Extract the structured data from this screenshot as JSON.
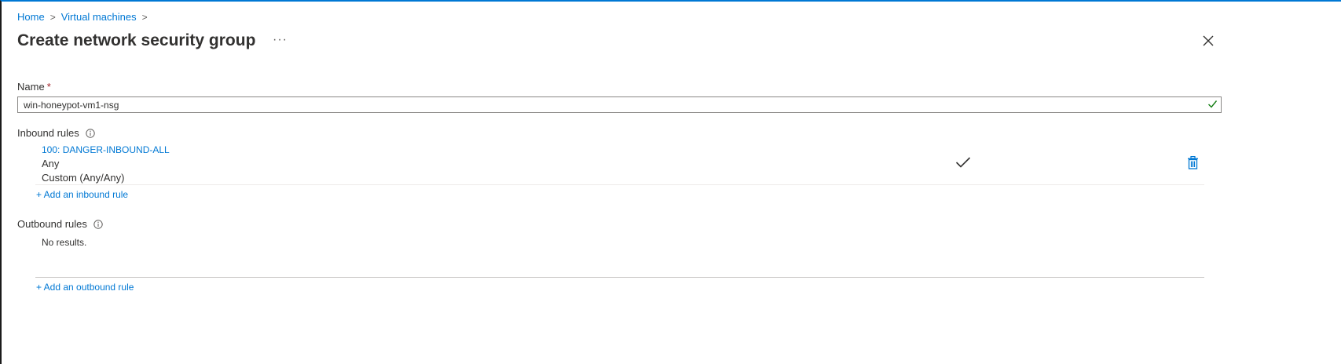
{
  "breadcrumb": {
    "home": "Home",
    "virtual_machines": "Virtual machines",
    "separator": ">"
  },
  "page": {
    "title": "Create network security group",
    "more": "···"
  },
  "form": {
    "name_label": "Name",
    "required_marker": "*",
    "name_value": "win-honeypot-vm1-nsg"
  },
  "inbound": {
    "label": "Inbound rules",
    "rules": [
      {
        "name": "100: DANGER-INBOUND-ALL",
        "source": "Any",
        "protocol": "Custom (Any/Any)"
      }
    ],
    "add_label": "+ Add an inbound rule"
  },
  "outbound": {
    "label": "Outbound rules",
    "empty_text": "No results.",
    "add_label": "+ Add an outbound rule"
  },
  "icons": {
    "close": "close-icon",
    "info": "info-icon",
    "check": "checkmark-icon",
    "delete": "trash-icon"
  },
  "colors": {
    "accent": "#0078d4",
    "success": "#107c10",
    "required": "#a4262c"
  }
}
